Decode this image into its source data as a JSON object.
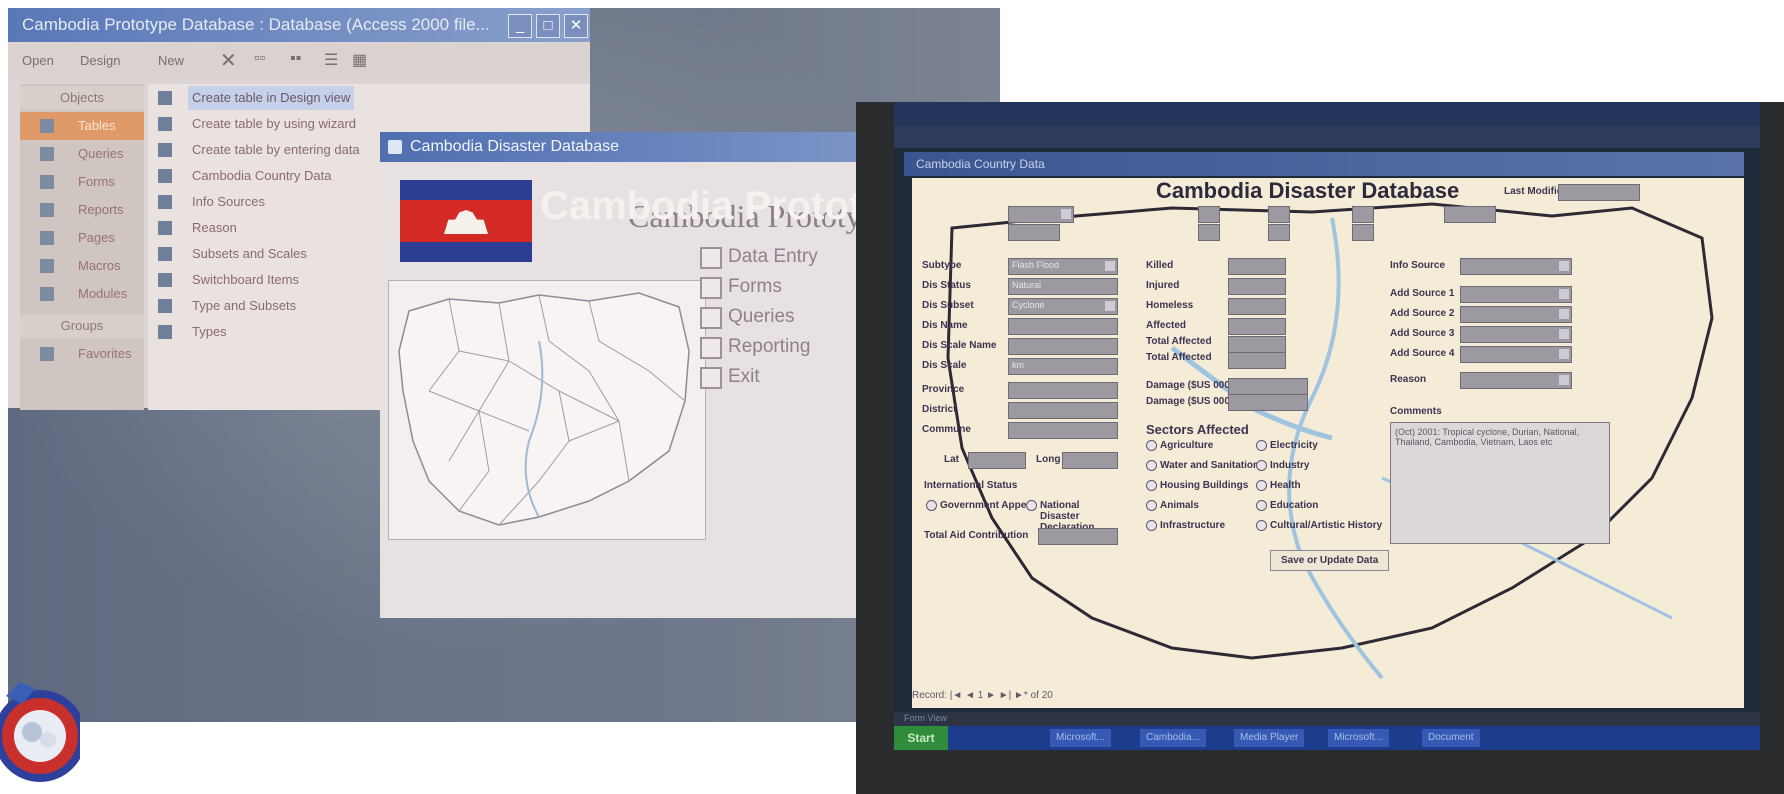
{
  "left": {
    "window_title": "Cambodia Prototype Database : Database (Access 2000 file...",
    "toolbar": {
      "open": "Open",
      "design": "Design",
      "new": "New"
    },
    "objects_header": "Objects",
    "objects": [
      "Tables",
      "Queries",
      "Forms",
      "Reports",
      "Pages",
      "Macros",
      "Modules"
    ],
    "groups_header": "Groups",
    "favorites": "Favorites",
    "items": [
      "Create table in Design view",
      "Create table by using wizard",
      "Create table by entering data",
      "Cambodia Country Data",
      "Info Sources",
      "Reason",
      "Subsets and Scales",
      "Switchboard Items",
      "Type and Subsets",
      "Types"
    ],
    "switchboard": {
      "title": "Cambodia Disaster Database",
      "banner_title": "Cambodia Protot",
      "banner_subtitle": "Cambodia Prototy",
      "buttons": [
        "Data Entry",
        "Forms",
        "Queries",
        "Reporting",
        "Exit"
      ]
    }
  },
  "right": {
    "window_title": "Cambodia Country Data",
    "form_title": "Cambodia Disaster Database",
    "last_modified_label": "Last Modified",
    "fields_left": [
      {
        "label": "Subtype",
        "value": "Flash Flood"
      },
      {
        "label": "Dis Status",
        "value": "Natural"
      },
      {
        "label": "Dis Subset",
        "value": "Cyclone"
      },
      {
        "label": "Dis Name",
        "value": ""
      },
      {
        "label": "Dis Scale Name",
        "value": ""
      },
      {
        "label": "Dis Scale",
        "value": "km"
      },
      {
        "label": "Province",
        "value": ""
      },
      {
        "label": "District",
        "value": ""
      },
      {
        "label": "Commune",
        "value": ""
      }
    ],
    "lat_label": "Lat",
    "long_label": "Long",
    "intl_status_label": "International Status",
    "intl_options": [
      "Government Appeal",
      "National Disaster Declaration"
    ],
    "total_aid_label": "Total Aid Contribution",
    "fields_mid": [
      "Killed",
      "Injured",
      "Homeless",
      "Affected",
      "Total Affected",
      "Total Affected"
    ],
    "damage_labels": [
      "Damage ($US 000's)",
      "Damage ($US 000's)"
    ],
    "sectors_label": "Sectors Affected",
    "sectors_left": [
      "Agriculture",
      "Water and Sanitation",
      "Housing Buildings",
      "Animals",
      "Infrastructure"
    ],
    "sectors_right": [
      "Electricity",
      "Industry",
      "Health",
      "Education",
      "Cultural/Artistic History"
    ],
    "sources_right": [
      "Info Source",
      "Add Source 1",
      "Add Source 2",
      "Add Source 3",
      "Add Source 4",
      "Reason"
    ],
    "comments_label": "Comments",
    "comments_text": "(Oct) 2001: Tropical cyclone, Durian, National, Thailand, Cambodia, Vietnam, Laos etc",
    "save_button": "Save or Update Data",
    "record_nav": "Record: |◄ ◄  1  ► ►| ►* of 20",
    "status_text": "Form View",
    "taskbar": [
      "Start",
      "Microsoft...",
      "Cambodia...",
      "Media Player",
      "Microsoft...",
      "Document"
    ]
  }
}
